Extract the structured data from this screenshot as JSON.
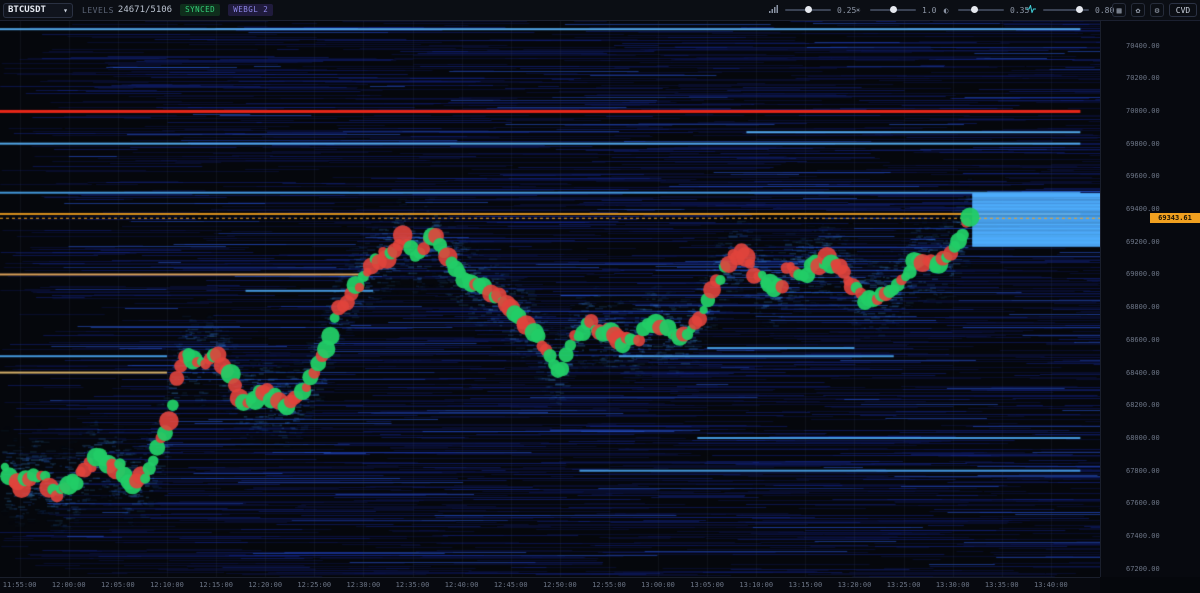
{
  "toolbar": {
    "symbol": "BTCUSDT",
    "levels_label": "LEVELS",
    "levels_value": "24671/5106",
    "synced_badge": "SYNCED",
    "webgl_badge": "WEBGL 2",
    "controls": [
      {
        "icon": "signal-icon",
        "value": "0.25",
        "level": 0.5
      },
      {
        "icon": "sun-icon",
        "value": "1.0",
        "level": 0.5
      },
      {
        "icon": "contrast-icon",
        "value": "0.35",
        "level": 0.35
      },
      {
        "icon": "pulse-icon",
        "value": "0.80",
        "level": 0.8
      }
    ],
    "cvd_label": "CVD"
  },
  "price_axis": {
    "ticks": [
      "70400.00",
      "70200.00",
      "70000.00",
      "69800.00",
      "69600.00",
      "69400.00",
      "69200.00",
      "69000.00",
      "68800.00",
      "68600.00",
      "68400.00",
      "68200.00",
      "68000.00",
      "67800.00",
      "67600.00",
      "67400.00",
      "67200.00"
    ],
    "current_price": "69343.61"
  },
  "time_axis": {
    "ticks": [
      "11:55:00",
      "12:00:00",
      "12:05:00",
      "12:10:00",
      "12:15:00",
      "12:20:00",
      "12:25:00",
      "12:30:00",
      "12:35:00",
      "12:40:00",
      "12:45:00",
      "12:50:00",
      "12:55:00",
      "13:00:00",
      "13:05:00",
      "13:10:00",
      "13:15:00",
      "13:20:00",
      "13:25:00",
      "13:30:00",
      "13:35:00",
      "13:40:00"
    ]
  },
  "colors": {
    "background": "#05070c",
    "bid_ask_buy": "#22cc66",
    "bid_ask_sell": "#e0443c",
    "liquidity_high": "#4fb3ff",
    "liquidity_low": "#10248a",
    "level_red": "#ff2a1a",
    "level_orange": "#f0a020",
    "current_price": "#f0a020"
  },
  "chart_data": {
    "type": "heatmap",
    "price_range": [
      67150,
      70550
    ],
    "time_range": [
      "11:53:00",
      "13:45:00"
    ],
    "current_price": 69343.61,
    "price_path": [
      {
        "t": "11:53:30",
        "p": 67800
      },
      {
        "t": "11:55:00",
        "p": 67720
      },
      {
        "t": "11:57:00",
        "p": 67800
      },
      {
        "t": "11:59:00",
        "p": 67650
      },
      {
        "t": "12:01:00",
        "p": 67760
      },
      {
        "t": "12:03:00",
        "p": 67900
      },
      {
        "t": "12:05:00",
        "p": 67820
      },
      {
        "t": "12:06:30",
        "p": 67720
      },
      {
        "t": "12:08:00",
        "p": 67780
      },
      {
        "t": "12:10:00",
        "p": 68050
      },
      {
        "t": "12:11:00",
        "p": 68350
      },
      {
        "t": "12:12:00",
        "p": 68520
      },
      {
        "t": "12:13:30",
        "p": 68450
      },
      {
        "t": "12:15:00",
        "p": 68520
      },
      {
        "t": "12:16:30",
        "p": 68380
      },
      {
        "t": "12:18:00",
        "p": 68200
      },
      {
        "t": "12:20:00",
        "p": 68300
      },
      {
        "t": "12:22:00",
        "p": 68180
      },
      {
        "t": "12:24:00",
        "p": 68280
      },
      {
        "t": "12:26:00",
        "p": 68500
      },
      {
        "t": "12:27:30",
        "p": 68800
      },
      {
        "t": "12:29:00",
        "p": 68900
      },
      {
        "t": "12:31:00",
        "p": 69050
      },
      {
        "t": "12:33:00",
        "p": 69150
      },
      {
        "t": "12:34:00",
        "p": 69220
      },
      {
        "t": "12:35:30",
        "p": 69100
      },
      {
        "t": "12:37:00",
        "p": 69250
      },
      {
        "t": "12:38:00",
        "p": 69150
      },
      {
        "t": "12:40:00",
        "p": 69000
      },
      {
        "t": "12:41:00",
        "p": 68950
      },
      {
        "t": "12:43:00",
        "p": 68900
      },
      {
        "t": "12:45:00",
        "p": 68780
      },
      {
        "t": "12:47:00",
        "p": 68700
      },
      {
        "t": "12:48:00",
        "p": 68580
      },
      {
        "t": "12:50:00",
        "p": 68400
      },
      {
        "t": "12:51:30",
        "p": 68620
      },
      {
        "t": "12:53:00",
        "p": 68700
      },
      {
        "t": "12:55:00",
        "p": 68640
      },
      {
        "t": "12:57:00",
        "p": 68580
      },
      {
        "t": "12:58:30",
        "p": 68650
      },
      {
        "t": "13:00:00",
        "p": 68700
      },
      {
        "t": "13:02:00",
        "p": 68620
      },
      {
        "t": "13:04:00",
        "p": 68700
      },
      {
        "t": "13:05:30",
        "p": 68900
      },
      {
        "t": "13:07:00",
        "p": 69050
      },
      {
        "t": "13:08:30",
        "p": 69150
      },
      {
        "t": "13:10:00",
        "p": 69000
      },
      {
        "t": "13:12:00",
        "p": 68900
      },
      {
        "t": "13:13:30",
        "p": 69050
      },
      {
        "t": "13:15:00",
        "p": 69000
      },
      {
        "t": "13:17:00",
        "p": 69100
      },
      {
        "t": "13:18:30",
        "p": 69050
      },
      {
        "t": "13:20:00",
        "p": 68920
      },
      {
        "t": "13:21:30",
        "p": 68850
      },
      {
        "t": "13:23:00",
        "p": 68880
      },
      {
        "t": "13:25:00",
        "p": 68950
      },
      {
        "t": "13:26:30",
        "p": 69100
      },
      {
        "t": "13:28:00",
        "p": 69050
      },
      {
        "t": "13:30:00",
        "p": 69120
      },
      {
        "t": "13:31:00",
        "p": 69250
      },
      {
        "t": "13:31:45",
        "p": 69343.61
      }
    ],
    "levels": [
      {
        "price": 70500,
        "from": "11:53:00",
        "to": "13:43:00",
        "color": "#5ab8ff",
        "type": "ask"
      },
      {
        "price": 70000,
        "from": "11:53:00",
        "to": "13:43:00",
        "color": "#ff2a1a",
        "type": "ask"
      },
      {
        "price": 69870,
        "from": "13:09:00",
        "to": "13:43:00",
        "color": "#5ab8ff",
        "type": "ask"
      },
      {
        "price": 69800,
        "from": "11:53:00",
        "to": "13:43:00",
        "color": "#5ab8ff",
        "type": "ask"
      },
      {
        "price": 69500,
        "from": "11:53:00",
        "to": "13:43:00",
        "color": "#4aa6f0",
        "type": "ask"
      },
      {
        "price": 69370,
        "from": "11:53:00",
        "to": "13:43:00",
        "color": "#f0a020",
        "type": "price"
      },
      {
        "price": 69000,
        "from": "11:53:00",
        "to": "12:30:00",
        "color": "#f0b060",
        "type": "bid"
      },
      {
        "price": 68900,
        "from": "12:18:00",
        "to": "12:31:00",
        "color": "#4aa6f0",
        "type": "bid"
      },
      {
        "price": 68500,
        "from": "11:53:00",
        "to": "12:10:00",
        "color": "#4aa6f0",
        "type": "bid"
      },
      {
        "price": 68550,
        "from": "13:05:00",
        "to": "13:20:00",
        "color": "#4aa6f0",
        "type": "bid"
      },
      {
        "price": 68500,
        "from": "12:56:00",
        "to": "13:24:00",
        "color": "#4aa6f0",
        "type": "bid"
      },
      {
        "price": 68400,
        "from": "11:53:00",
        "to": "12:10:00",
        "color": "#e8c070",
        "type": "bid"
      },
      {
        "price": 68000,
        "from": "13:04:00",
        "to": "13:43:00",
        "color": "#4aa6f0",
        "type": "bid"
      },
      {
        "price": 67800,
        "from": "12:52:00",
        "to": "13:43:00",
        "color": "#4aa6f0",
        "type": "bid"
      }
    ],
    "ask_block": {
      "from_price": 69180,
      "to_price": 69500,
      "start": "13:32:00",
      "color": "#4fb3ff"
    }
  }
}
